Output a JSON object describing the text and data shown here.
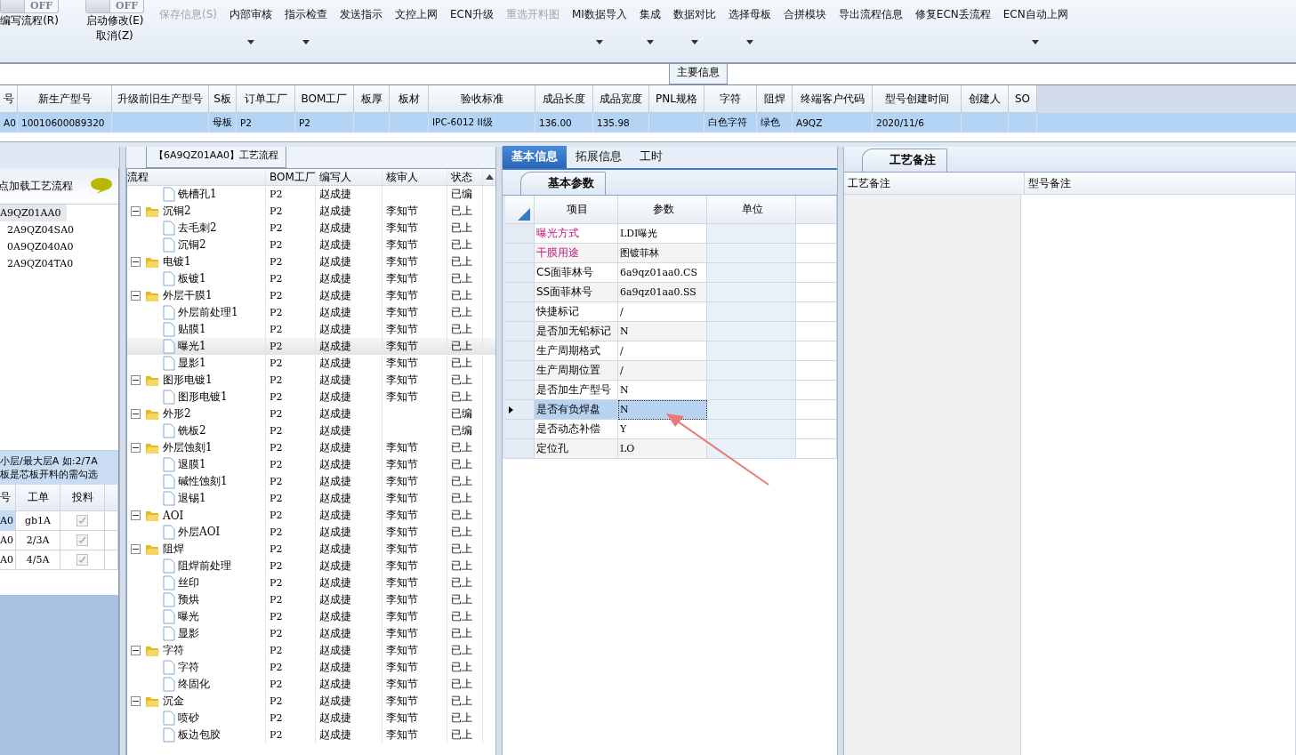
{
  "toolbar": {
    "toggles": [
      {
        "label": "OFF",
        "on": false
      },
      {
        "label": "OFF",
        "on": false
      }
    ],
    "toggle_labels": [
      {
        "lines": [
          "编写流程(R)"
        ]
      },
      {
        "lines": [
          "启动修改(E)",
          "取消(Z)"
        ]
      }
    ],
    "buttons": [
      {
        "label": "保存信息(S)",
        "disabled": true,
        "dropdown": false
      },
      {
        "label": "内部审核",
        "disabled": false,
        "dropdown": true
      },
      {
        "label": "指示检查",
        "disabled": false,
        "dropdown": true
      },
      {
        "label": "发送指示",
        "disabled": false,
        "dropdown": false
      },
      {
        "label": "文控上网",
        "disabled": false,
        "dropdown": false
      },
      {
        "label": "ECN升级",
        "disabled": false,
        "dropdown": false
      },
      {
        "label": "重选开料图",
        "disabled": true,
        "dropdown": false
      },
      {
        "label": "MI数据导入",
        "disabled": false,
        "dropdown": true
      },
      {
        "label": "集成",
        "disabled": false,
        "dropdown": true
      },
      {
        "label": "数据对比",
        "disabled": false,
        "dropdown": true
      },
      {
        "label": "选择母板",
        "disabled": false,
        "dropdown": true
      },
      {
        "label": "合拼模块",
        "disabled": false,
        "dropdown": false
      },
      {
        "label": "导出流程信息",
        "disabled": false,
        "dropdown": false
      },
      {
        "label": "修复ECN丢流程",
        "disabled": false,
        "dropdown": false
      },
      {
        "label": "ECN自动上网",
        "disabled": false,
        "dropdown": true
      }
    ]
  },
  "main_info": {
    "title": "主要信息",
    "columns": [
      "号",
      "新生产型号",
      "升级前旧生产型号",
      "S板",
      "订单工厂",
      "BOM工厂",
      "板厚",
      "板材",
      "验收标准",
      "成品长度",
      "成品宽度",
      "PNL规格",
      "字符",
      "阻焊",
      "终端客户代码",
      "型号创建时间",
      "创建人",
      "SO"
    ],
    "rows": [
      {
        "selected": true,
        "cells": [
          "A0",
          "10010600089320",
          "",
          "母板",
          "P2",
          "P2",
          "",
          "",
          "IPC-6012 II级",
          "136.00",
          "135.98",
          "",
          "白色字符",
          "绿色",
          "A9QZ",
          "2020/11/6",
          "",
          ""
        ]
      }
    ]
  },
  "left_panel": {
    "header": "点加载工艺流程",
    "items": [
      {
        "label": "A9QZ01AA0",
        "selected": true
      },
      {
        "label": "2A9QZ04SA0",
        "selected": false
      },
      {
        "label": "0A9QZ040A0",
        "selected": false
      },
      {
        "label": "2A9QZ04TA0",
        "selected": false
      }
    ],
    "note_lines": [
      "小层/最大层A 如:2/7A",
      "板是芯板开料的需勾选"
    ],
    "columns": [
      "号",
      "工单",
      "投料"
    ],
    "rows": [
      {
        "col_1": "A0",
        "order": "gb1A",
        "fed": true,
        "selected": true
      },
      {
        "col_1": "A0",
        "order": "2/3A",
        "fed": true,
        "selected": false
      },
      {
        "col_1": "A0",
        "order": "4/5A",
        "fed": true,
        "selected": false
      }
    ]
  },
  "flow": {
    "title": "【6A9QZ01AA0】工艺流程",
    "columns": [
      "流程",
      "BOM工厂",
      "编写人",
      "核审人",
      "状态"
    ],
    "items": [
      {
        "name": "铣槽孔1",
        "kind": "file",
        "bom": "P2",
        "writer": "赵成捷",
        "status": "已编",
        "selected": false
      },
      {
        "name": "沉铜2",
        "kind": "folder",
        "expanded": true,
        "bom": "P2",
        "writer": "赵成捷",
        "reviewer": "李知节",
        "status": "已上",
        "selected": false,
        "children": [
          {
            "name": "去毛刺2",
            "kind": "file",
            "bom": "P2",
            "writer": "赵成捷",
            "reviewer": "李知节",
            "status": "已上",
            "selected": false
          },
          {
            "name": "沉铜2",
            "kind": "file",
            "bom": "P2",
            "writer": "赵成捷",
            "reviewer": "李知节",
            "status": "已上",
            "selected": false
          }
        ]
      },
      {
        "name": "电镀1",
        "kind": "folder",
        "expanded": true,
        "bom": "P2",
        "writer": "赵成捷",
        "reviewer": "李知节",
        "status": "已上",
        "selected": false,
        "children": [
          {
            "name": "板镀1",
            "kind": "file",
            "bom": "P2",
            "writer": "赵成捷",
            "reviewer": "李知节",
            "status": "已上",
            "selected": false
          }
        ]
      },
      {
        "name": "外层干膜1",
        "kind": "folder",
        "expanded": true,
        "bom": "P2",
        "writer": "赵成捷",
        "reviewer": "李知节",
        "status": "已上",
        "selected": false,
        "children": [
          {
            "name": "外层前处理1",
            "kind": "file",
            "bom": "P2",
            "writer": "赵成捷",
            "reviewer": "李知节",
            "status": "已上",
            "selected": false
          },
          {
            "name": "贴膜1",
            "kind": "file",
            "bom": "P2",
            "writer": "赵成捷",
            "reviewer": "李知节",
            "status": "已上",
            "selected": false
          },
          {
            "name": "曝光1",
            "kind": "file",
            "bom": "P2",
            "writer": "赵成捷",
            "reviewer": "李知节",
            "status": "已上",
            "selected": true
          },
          {
            "name": "显影1",
            "kind": "file",
            "bom": "P2",
            "writer": "赵成捷",
            "reviewer": "李知节",
            "status": "已上",
            "selected": false
          }
        ]
      },
      {
        "name": "图形电镀1",
        "kind": "folder",
        "expanded": true,
        "bom": "P2",
        "writer": "赵成捷",
        "reviewer": "李知节",
        "status": "已上",
        "selected": false,
        "children": [
          {
            "name": "图形电镀1",
            "kind": "file",
            "bom": "P2",
            "writer": "赵成捷",
            "reviewer": "李知节",
            "status": "已上",
            "selected": false
          }
        ]
      },
      {
        "name": "外形2",
        "kind": "folder",
        "expanded": true,
        "bom": "P2",
        "writer": "赵成捷",
        "status": "已编",
        "selected": false,
        "children": [
          {
            "name": "铣板2",
            "kind": "file",
            "bom": "P2",
            "writer": "赵成捷",
            "status": "已编",
            "selected": false
          }
        ]
      },
      {
        "name": "外层蚀刻1",
        "kind": "folder",
        "expanded": true,
        "bom": "P2",
        "writer": "赵成捷",
        "reviewer": "李知节",
        "status": "已上",
        "selected": false,
        "children": [
          {
            "name": "退膜1",
            "kind": "file",
            "bom": "P2",
            "writer": "赵成捷",
            "reviewer": "李知节",
            "status": "已上",
            "selected": false
          },
          {
            "name": "碱性蚀刻1",
            "kind": "file",
            "bom": "P2",
            "writer": "赵成捷",
            "reviewer": "李知节",
            "status": "已上",
            "selected": false
          },
          {
            "name": "退锡1",
            "kind": "file",
            "bom": "P2",
            "writer": "赵成捷",
            "reviewer": "李知节",
            "status": "已上",
            "selected": false
          }
        ]
      },
      {
        "name": "AOI",
        "kind": "folder",
        "expanded": true,
        "bom": "P2",
        "writer": "赵成捷",
        "reviewer": "李知节",
        "status": "已上",
        "selected": false,
        "children": [
          {
            "name": "外层AOI",
            "kind": "file",
            "bom": "P2",
            "writer": "赵成捷",
            "reviewer": "李知节",
            "status": "已上",
            "selected": false
          }
        ]
      },
      {
        "name": "阻焊",
        "kind": "folder",
        "expanded": true,
        "bom": "P2",
        "writer": "赵成捷",
        "reviewer": "李知节",
        "status": "已上",
        "selected": false,
        "children": [
          {
            "name": "阻焊前处理",
            "kind": "file",
            "bom": "P2",
            "writer": "赵成捷",
            "reviewer": "李知节",
            "status": "已上",
            "selected": false
          },
          {
            "name": "丝印",
            "kind": "file",
            "bom": "P2",
            "writer": "赵成捷",
            "reviewer": "李知节",
            "status": "已上",
            "selected": false
          },
          {
            "name": "预烘",
            "kind": "file",
            "bom": "P2",
            "writer": "赵成捷",
            "reviewer": "李知节",
            "status": "已上",
            "selected": false
          },
          {
            "name": "曝光",
            "kind": "file",
            "bom": "P2",
            "writer": "赵成捷",
            "reviewer": "李知节",
            "status": "已上",
            "selected": false
          },
          {
            "name": "显影",
            "kind": "file",
            "bom": "P2",
            "writer": "赵成捷",
            "reviewer": "李知节",
            "status": "已上",
            "selected": false
          }
        ]
      },
      {
        "name": "字符",
        "kind": "folder",
        "expanded": true,
        "bom": "P2",
        "writer": "赵成捷",
        "reviewer": "李知节",
        "status": "已上",
        "selected": false,
        "children": [
          {
            "name": "字符",
            "kind": "file",
            "bom": "P2",
            "writer": "赵成捷",
            "reviewer": "李知节",
            "status": "已上",
            "selected": false
          },
          {
            "name": "终固化",
            "kind": "file",
            "bom": "P2",
            "writer": "赵成捷",
            "reviewer": "李知节",
            "status": "已上",
            "selected": false
          }
        ]
      },
      {
        "name": "沉金",
        "kind": "folder",
        "expanded": true,
        "bom": "P2",
        "writer": "赵成捷",
        "reviewer": "李知节",
        "status": "已上",
        "selected": false,
        "children": [
          {
            "name": "喷砂",
            "kind": "file",
            "bom": "P2",
            "writer": "赵成捷",
            "reviewer": "李知节",
            "status": "已上",
            "selected": false
          },
          {
            "name": "板边包胶",
            "kind": "file",
            "bom": "P2",
            "writer": "赵成捷",
            "reviewer": "李知节",
            "status": "已上",
            "selected": false
          }
        ]
      }
    ]
  },
  "detail_tabs": [
    {
      "label": "基本信息",
      "selected": true
    },
    {
      "label": "拓展信息",
      "selected": false
    },
    {
      "label": "工时",
      "selected": false
    }
  ],
  "params": {
    "tab": "基本参数",
    "columns": [
      "项目",
      "参数",
      "单位"
    ],
    "rows": [
      {
        "item": "曝光方式",
        "value": "LDI曝光",
        "emphasized": true,
        "selected": false
      },
      {
        "item": "干膜用途",
        "value": "图镀菲林",
        "emphasized": true,
        "selected": false
      },
      {
        "item": "CS面菲林号",
        "value": "6a9qz01aa0.CS",
        "emphasized": false,
        "selected": false
      },
      {
        "item": "SS面菲林号",
        "value": "6a9qz01aa0.SS",
        "emphasized": false,
        "selected": false
      },
      {
        "item": "快捷标记",
        "value": "/",
        "emphasized": false,
        "selected": false
      },
      {
        "item": "是否加无铅标记",
        "value": "N",
        "emphasized": false,
        "selected": false
      },
      {
        "item": "生产周期格式",
        "value": "/",
        "emphasized": false,
        "selected": false
      },
      {
        "item": "生产周期位置",
        "value": "/",
        "emphasized": false,
        "selected": false
      },
      {
        "item": "是否加生产型号",
        "value": "N",
        "emphasized": false,
        "selected": false
      },
      {
        "item": "是否有负焊盘",
        "value": "N",
        "emphasized": false,
        "selected": true
      },
      {
        "item": "是否动态补偿",
        "value": "Y",
        "emphasized": false,
        "selected": false
      },
      {
        "item": "定位孔",
        "value": "LO",
        "emphasized": false,
        "selected": false
      }
    ]
  },
  "remarks": {
    "tab": "工艺备注",
    "columns": [
      "工艺备注",
      "型号备注"
    ]
  }
}
